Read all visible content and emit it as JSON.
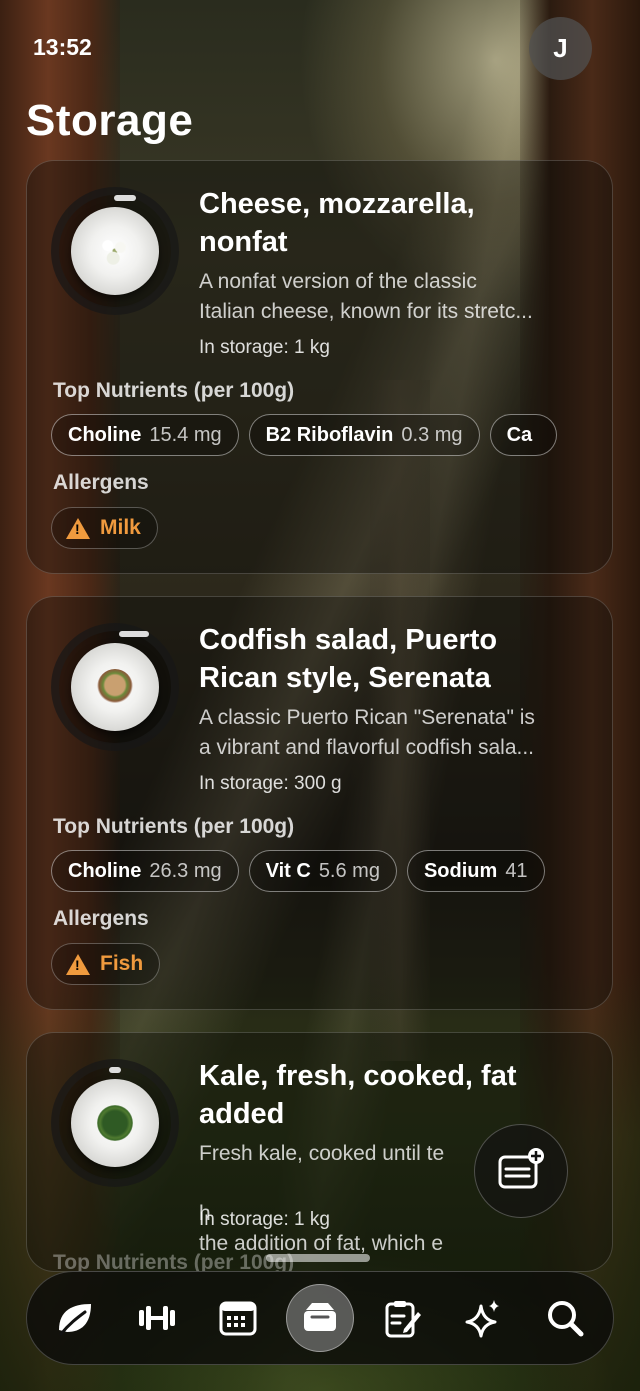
{
  "status_bar": {
    "time": "13:52"
  },
  "user": {
    "avatar_initial": "J"
  },
  "page": {
    "title": "Storage"
  },
  "labels": {
    "top_nutrients": "Top Nutrients (per 100g)",
    "allergens": "Allergens",
    "in_storage_prefix": "In storage:"
  },
  "items": [
    {
      "title": "Cheese, mozzarella, nonfat",
      "description_lines": [
        "A nonfat version of the classic",
        "Italian cheese, known for its stretc..."
      ],
      "storage": "In storage: 1 kg",
      "nutrients": [
        {
          "name": "Choline",
          "value": "15.4 mg"
        },
        {
          "name": "B2 Riboflavin",
          "value": "0.3 mg"
        },
        {
          "name": "Ca",
          "value": ""
        }
      ],
      "allergen": "Milk"
    },
    {
      "title": "Codfish salad, Puerto Rican style, Serenata",
      "description_lines": [
        "A classic Puerto Rican \"Serenata\" is",
        "a vibrant and flavorful codfish sala..."
      ],
      "storage": "In storage: 300 g",
      "nutrients": [
        {
          "name": "Choline",
          "value": "26.3 mg"
        },
        {
          "name": "Vit C",
          "value": "5.6 mg"
        },
        {
          "name": "Sodium",
          "value": "41"
        }
      ],
      "allergen": "Fish"
    },
    {
      "title": "Kale, fresh, cooked, fat added",
      "description_lines": [
        "Fresh kale, cooked until te",
        "the addition of fat, which e"
      ],
      "description_tail": [
        "h",
        "..."
      ],
      "storage": "In storage: 1 kg"
    }
  ],
  "tabbar": {
    "tabs": [
      {
        "icon": "leaf-icon"
      },
      {
        "icon": "dumbbell-icon"
      },
      {
        "icon": "calendar-icon"
      },
      {
        "icon": "storage-tray-icon",
        "active": true
      },
      {
        "icon": "notes-icon"
      },
      {
        "icon": "sparkles-icon"
      },
      {
        "icon": "search-icon"
      }
    ]
  },
  "colors": {
    "allergen": "#f09a3e",
    "active_tab": "#787878"
  }
}
